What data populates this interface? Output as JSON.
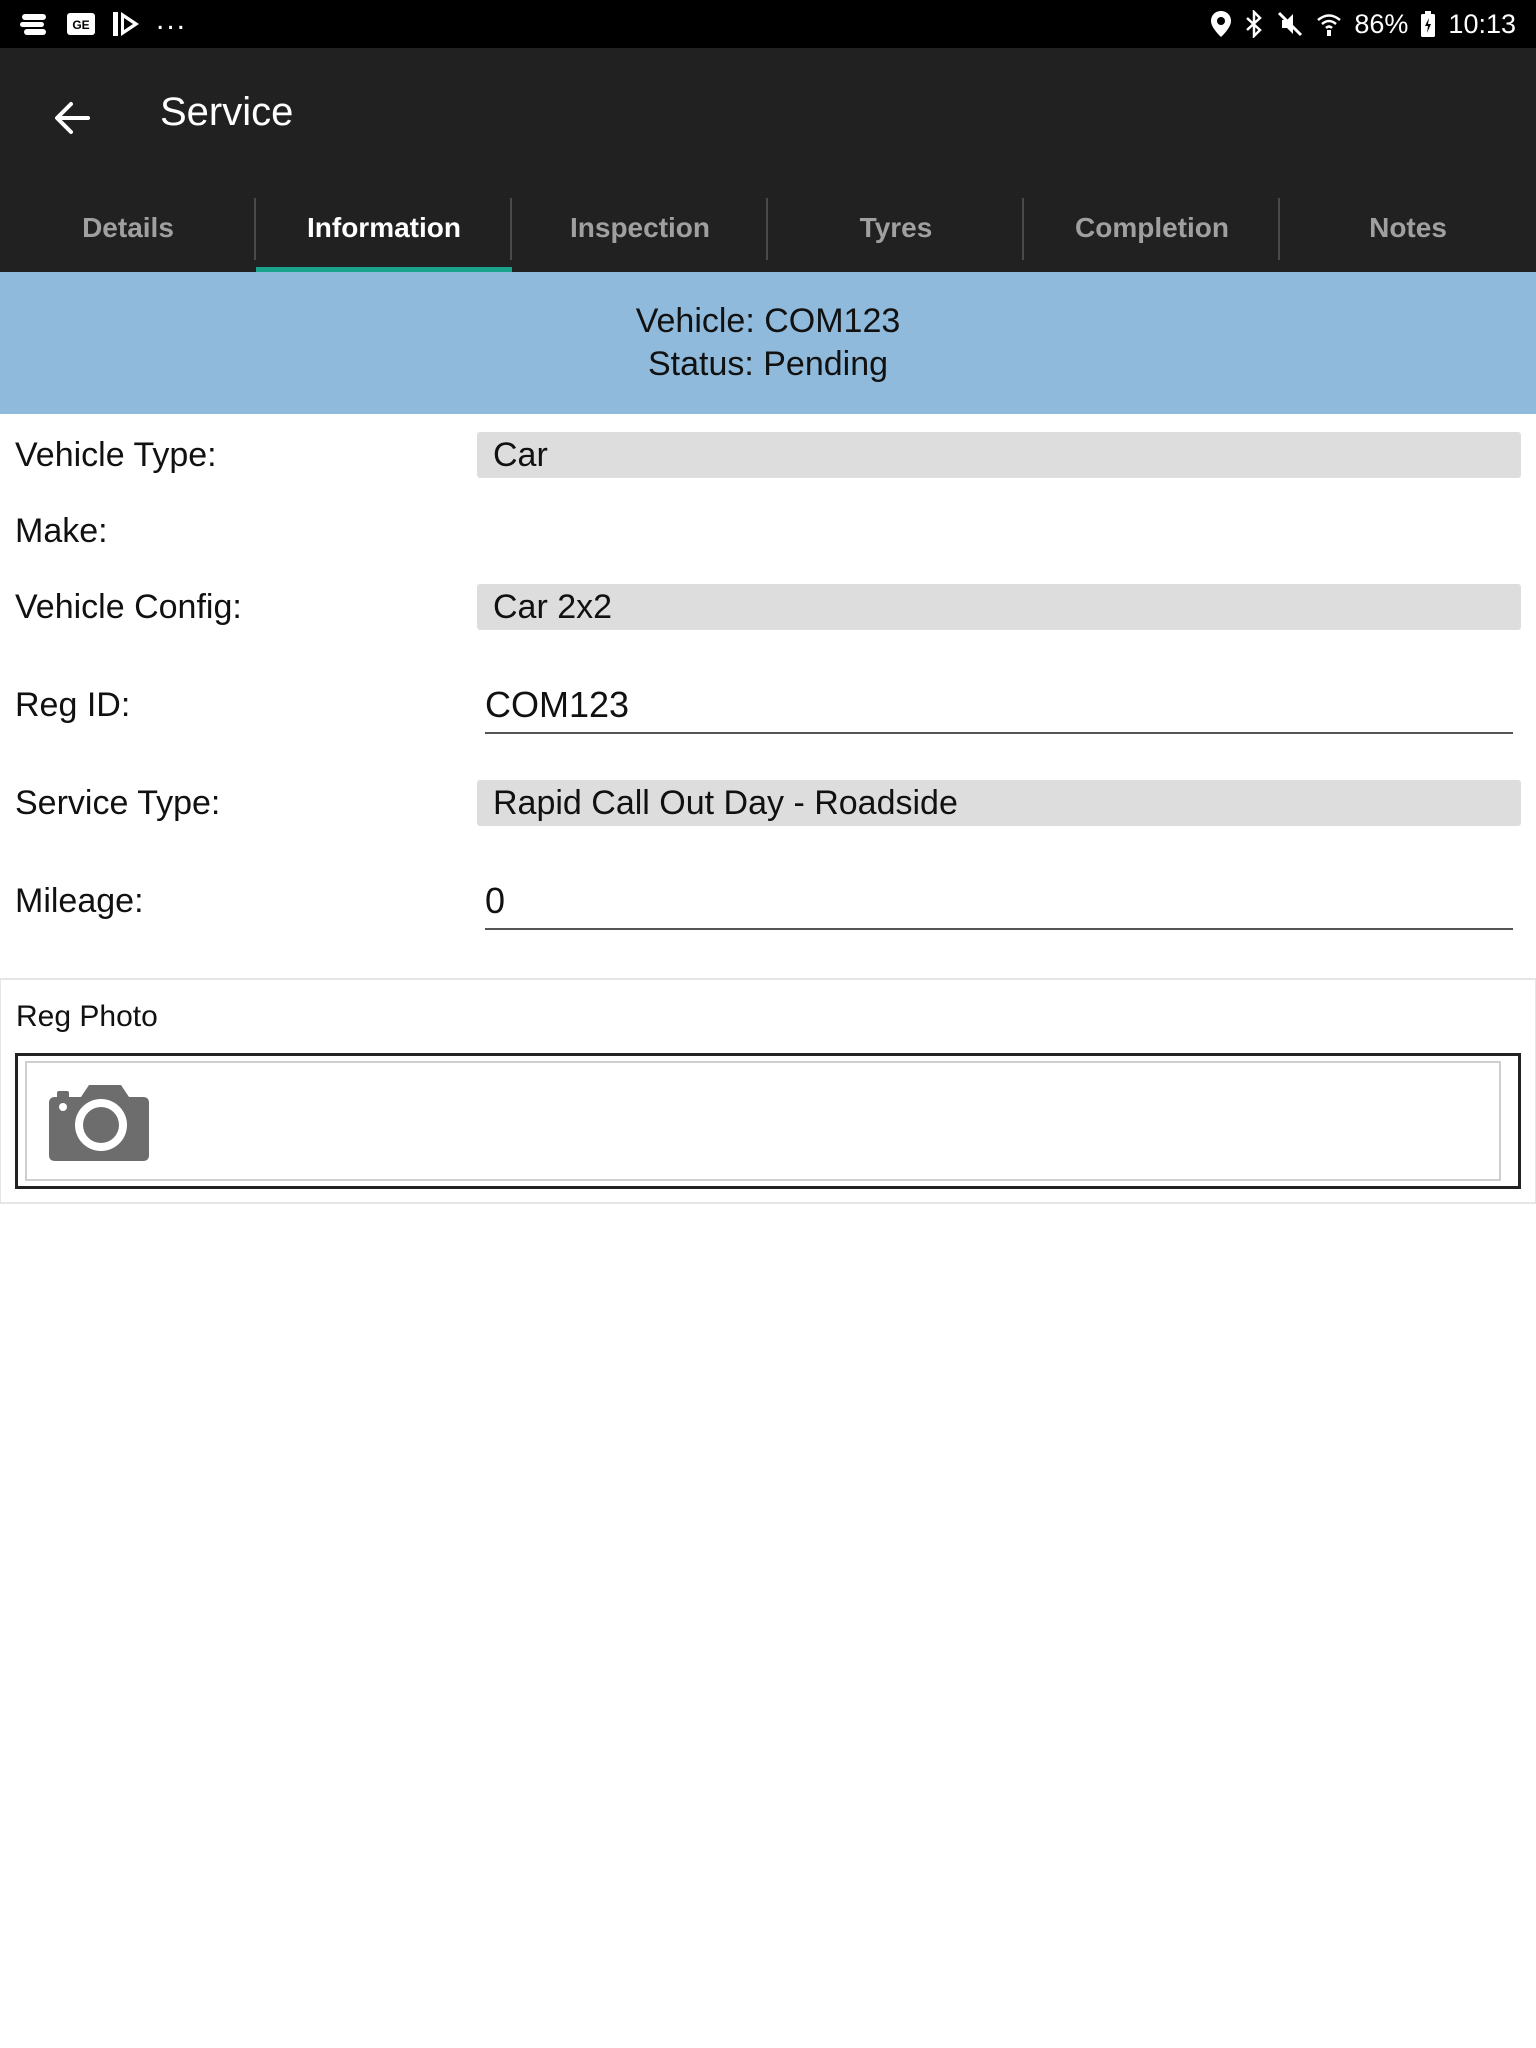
{
  "status_bar": {
    "battery": "86%",
    "time": "10:13",
    "left_icons": [
      "app-notification-icon",
      "ge-notification-icon",
      "play-notification-icon"
    ],
    "more": "...",
    "right_icons": [
      "location-icon",
      "bluetooth-icon",
      "mute-icon",
      "wifi-icon",
      "battery-icon"
    ]
  },
  "toolbar": {
    "title": "Service",
    "back_icon": "arrow-left-icon"
  },
  "tabs": [
    {
      "label": "Details",
      "active": false
    },
    {
      "label": "Information",
      "active": true
    },
    {
      "label": "Inspection",
      "active": false
    },
    {
      "label": "Tyres",
      "active": false
    },
    {
      "label": "Completion",
      "active": false
    },
    {
      "label": "Notes",
      "active": false
    }
  ],
  "banner": {
    "vehicle": "Vehicle: COM123",
    "status": "Status: Pending"
  },
  "form": {
    "vehicle_type": {
      "label": "Vehicle Type:",
      "value": "Car"
    },
    "make": {
      "label": "Make:"
    },
    "vehicle_config": {
      "label": "Vehicle Config:",
      "value": "Car 2x2"
    },
    "reg_id": {
      "label": "Reg ID:",
      "value": "COM123"
    },
    "service_type": {
      "label": "Service Type:",
      "value": "Rapid Call Out Day - Roadside"
    },
    "mileage": {
      "label": "Mileage:",
      "value": "0"
    }
  },
  "reg_photo": {
    "title": "Reg Photo",
    "icon": "camera-icon"
  },
  "colors": {
    "app_bar": "#212121",
    "tab_indicator": "#1aa38c",
    "banner": "#8fbadb",
    "select_bg": "#dddddd"
  }
}
